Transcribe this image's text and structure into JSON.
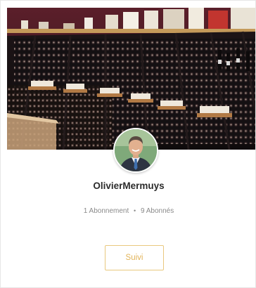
{
  "profile": {
    "name": "OlivierMermuys",
    "following_label": "1 Abonnement",
    "separator": "•",
    "followers_label": "9 Abonnés",
    "follow_button_label": "Suivi"
  },
  "colors": {
    "accent": "#e2b459",
    "accent_border": "#e9c87e",
    "name_text": "#2b2b2b",
    "muted_text": "#8a8a8a"
  }
}
